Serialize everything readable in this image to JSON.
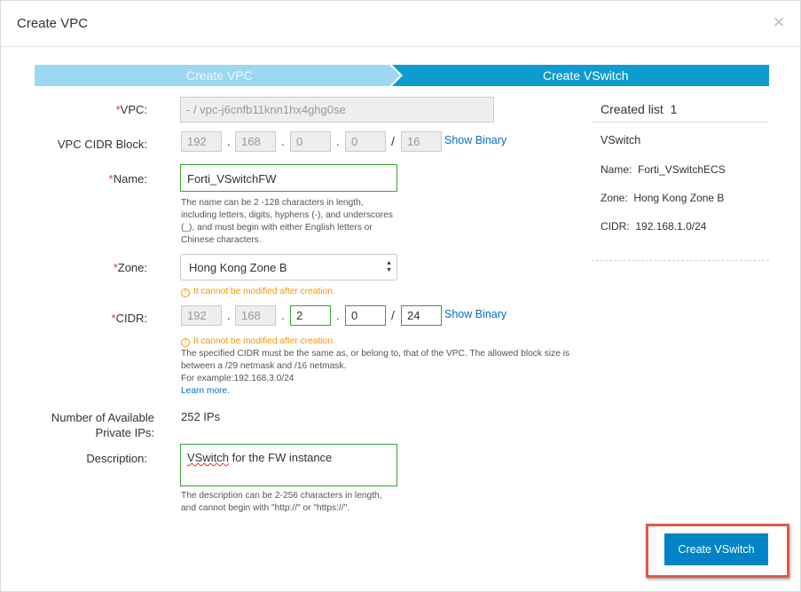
{
  "dialog": {
    "title": "Create VPC",
    "close_symbol": "×"
  },
  "steps": [
    {
      "label": "Create VPC",
      "state": "done",
      "color": "#9dd8f2"
    },
    {
      "label": "Create VSwitch",
      "state": "active",
      "color": "#0d9bd0"
    }
  ],
  "form": {
    "vpc": {
      "label": "VPC:",
      "value": "- / vpc-j6cnfb11knn1hx4ghg0se"
    },
    "vpc_cidr": {
      "label": "VPC CIDR Block:",
      "octets": [
        "192",
        "168",
        "0",
        "0"
      ],
      "mask": "16",
      "show_binary": "Show Binary"
    },
    "name": {
      "label": "Name:",
      "value": "Forti_VSwitchFW",
      "help": [
        "The name can be 2 -128 characters in length,",
        "including letters, digits, hyphens (-), and underscores",
        "(_), and must begin with either English letters or",
        "Chinese characters."
      ]
    },
    "zone": {
      "label": "Zone:",
      "value": "Hong Kong Zone B",
      "warning": "It cannot be modified after creation."
    },
    "cidr": {
      "label": "CIDR:",
      "octets": [
        "192",
        "168",
        "2",
        "0"
      ],
      "mask": "24",
      "show_binary": "Show Binary",
      "warning": "It cannot be modified after creation.",
      "help": [
        "The specified CIDR must be the same as, or belong to, that of the VPC. The allowed block size is",
        "between a /29 netmask and /16 netmask.",
        "For example:192.168.3.0/24"
      ],
      "learn_more": "Learn more."
    },
    "available_ips": {
      "label_line1": "Number of Available",
      "label_line2": "Private IPs:",
      "value": "252 IPs"
    },
    "description": {
      "label": "Description:",
      "value_word1": "VSwitch",
      "value_rest": " for the FW instance",
      "help": [
        "The description can be 2-256 characters in length,",
        "and cannot begin with \"http://\" or \"https://\"."
      ]
    }
  },
  "created_list": {
    "title": "Created list",
    "count": "1",
    "type": "VSwitch",
    "name_label": "Name:",
    "name_value": "Forti_VSwitchECS",
    "zone_label": "Zone:",
    "zone_value": "Hong Kong Zone B",
    "cidr_label": "CIDR:",
    "cidr_value": "192.168.1.0/24"
  },
  "actions": {
    "create_vswitch": "Create VSwitch"
  },
  "symbols": {
    "dot": ".",
    "slash": "/",
    "required": "*",
    "warn": "!"
  },
  "colors": {
    "primary": "#0084c7",
    "valid_border": "#3aa23a",
    "warning": "#f39800",
    "highlight": "#e0584a"
  }
}
